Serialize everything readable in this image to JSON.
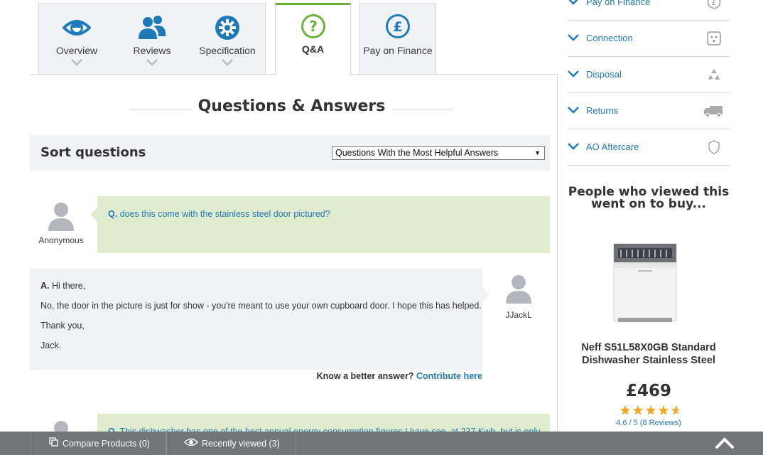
{
  "tabs": {
    "overview": "Overview",
    "reviews": "Reviews",
    "specification": "Specification",
    "qa": "Q&A",
    "finance": "Pay on Finance"
  },
  "qa": {
    "title": "Questions & Answers",
    "sort_label": "Sort questions",
    "sort_selected": "Questions With the Most Helpful Answers",
    "questions": [
      {
        "author": "Anonymous",
        "q_prefix": "Q.",
        "text": "does this come with the stainless steel door pictured?",
        "answer": {
          "author": "JJackL",
          "a_prefix": "A.",
          "lines": [
            "Hi there,",
            "No, the door in the picture is just for show - you're meant to use your own cupboard door. I hope this has helped.",
            "Thank you,",
            "Jack."
          ]
        },
        "better_prompt": "Know a better answer?",
        "contribute": "Contribute here"
      },
      {
        "q_prefix": "Q.",
        "text": "This dishwasher has one of the best annual energy consumption figures I have see, at 237 Kwh, but is only"
      }
    ]
  },
  "sidebar": {
    "items": [
      {
        "label": "Pay on Finance",
        "icon": "pound-icon"
      },
      {
        "label": "Connection",
        "icon": "plug-icon"
      },
      {
        "label": "Disposal",
        "icon": "recycle-icon"
      },
      {
        "label": "Returns",
        "icon": "truck-icon"
      },
      {
        "label": "AO Aftercare",
        "icon": "shield-icon"
      }
    ],
    "also_bought_title": "People who viewed this went on to buy...",
    "product": {
      "name": "Neff S51L58X0GB Standard Dishwasher Stainless Steel",
      "price": "£469",
      "rating": 4.6,
      "rating_text": "4.6 / 5 (8 Reviews)"
    }
  },
  "bottom_bar": {
    "compare": "Compare Products (0)",
    "recent": "Recently viewed (3)"
  },
  "colors": {
    "brand_blue": "#1f7ab8",
    "accent_green": "#6bb23b",
    "question_bg": "#e0ecce",
    "answer_bg": "#f1f2f6",
    "star": "#f5a623"
  }
}
